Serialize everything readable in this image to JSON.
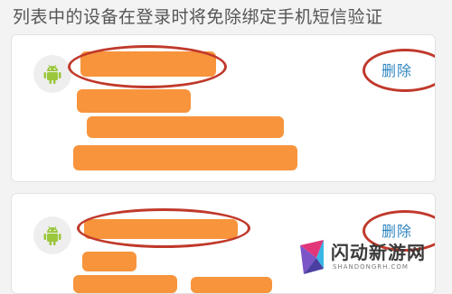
{
  "header": {
    "text": "列表中的设备在登录时将免除绑定手机短信验证"
  },
  "devices": [
    {
      "icon": "android-icon",
      "delete_label": "删除"
    },
    {
      "icon": "android-icon",
      "delete_label": "删除"
    }
  ],
  "watermark": {
    "brand": "闪动新游网",
    "domain": "SHANDONGRH.COM"
  },
  "colors": {
    "redaction": "#f7943c",
    "annotation": "#c0392b",
    "link": "#2f86bf",
    "android": "#9bc73d"
  }
}
